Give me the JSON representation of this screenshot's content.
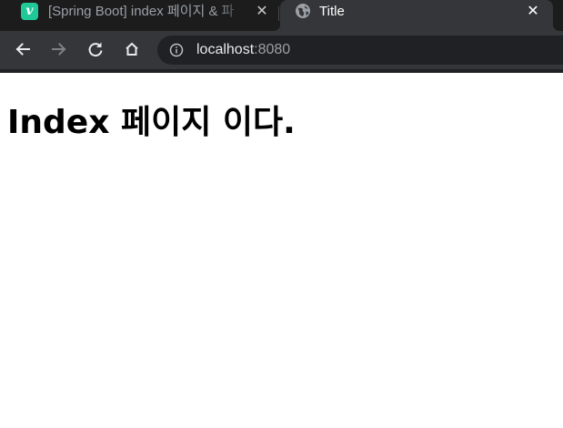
{
  "tabs": [
    {
      "title": "[Spring Boot] index 페이지 & 파",
      "favicon_letter": "v",
      "favicon_color": "#20c997",
      "favicon_icon": "velog-icon",
      "close_glyph": "✕",
      "active": false
    },
    {
      "title": "Title",
      "favicon_icon": "globe-icon",
      "close_glyph": "✕",
      "active": true
    }
  ],
  "toolbar": {
    "back_icon": "back-arrow-icon",
    "forward_icon": "forward-arrow-icon",
    "reload_icon": "reload-icon",
    "home_icon": "home-icon",
    "site_info_icon": "info-icon",
    "url_host": "localhost",
    "url_port": ":8080"
  },
  "page": {
    "heading": "Index 페이지 이다."
  },
  "colors": {
    "tabstrip_bg": "#1c1c1d",
    "toolbar_bg": "#35363a",
    "omnibox_bg": "#202124",
    "page_bg": "#ffffff"
  }
}
